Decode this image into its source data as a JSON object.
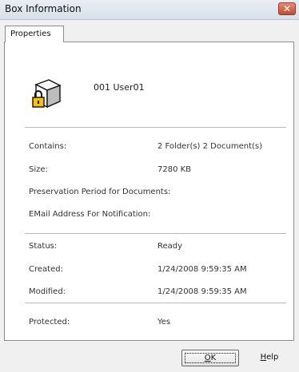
{
  "window": {
    "title": "Box Information",
    "close_glyph": "✕"
  },
  "tabs": [
    {
      "label": "Properties"
    }
  ],
  "box": {
    "name": "001 User01",
    "icon": "locked-box-icon"
  },
  "properties": {
    "contains_label": "Contains:",
    "contains_value": "2 Folder(s)  2 Document(s)",
    "size_label": "Size:",
    "size_value": "7280 KB",
    "preservation_label": "Preservation Period for Documents:",
    "preservation_value": "",
    "email_label": "EMail Address For Notification:",
    "email_value": "",
    "status_label": "Status:",
    "status_value": "Ready",
    "created_label": "Created:",
    "created_value": "1/24/2008 9:59:35 AM",
    "modified_label": "Modified:",
    "modified_value": "1/24/2008 9:59:35 AM",
    "protected_label": "Protected:",
    "protected_value": "Yes"
  },
  "buttons": {
    "ok_mnemonic": "O",
    "ok_rest": "K",
    "help_mnemonic": "H",
    "help_rest": "elp"
  }
}
